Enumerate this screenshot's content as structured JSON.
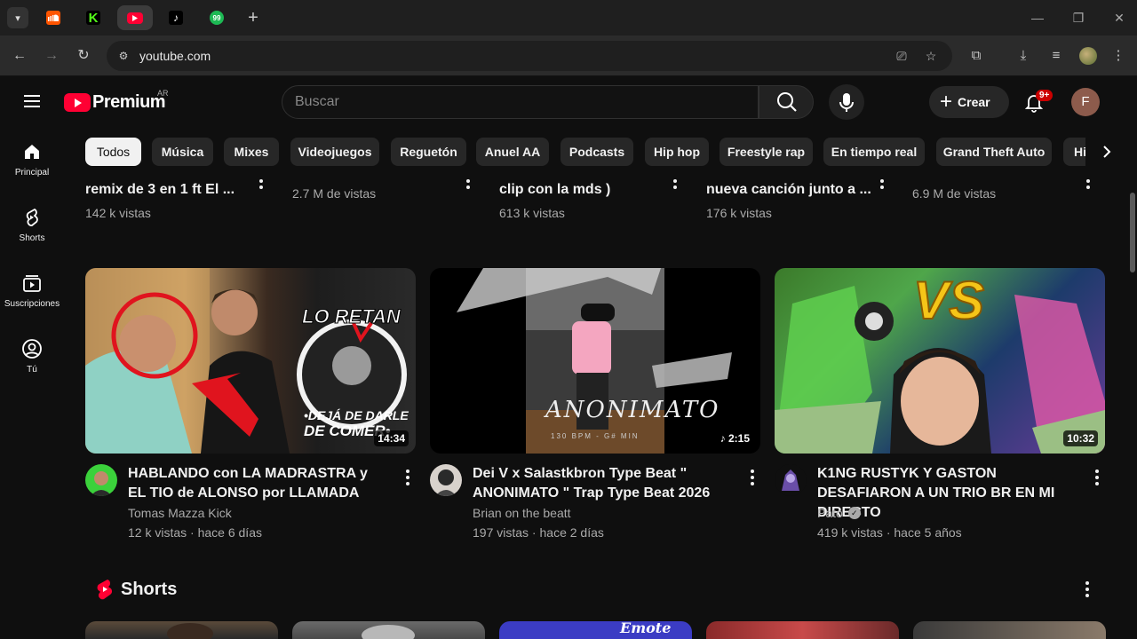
{
  "browser": {
    "tabs": [
      {
        "name": "soundcloud",
        "glyph": "",
        "color": "#ff5500",
        "active": false
      },
      {
        "name": "kick",
        "glyph": "K",
        "color": "#53fc18",
        "active": false
      },
      {
        "name": "youtube",
        "glyph": "",
        "color": "#ff0033",
        "active": true
      },
      {
        "name": "tiktok",
        "glyph": "♪",
        "color": "#000000",
        "active": false
      },
      {
        "name": "kick-99",
        "glyph": "99",
        "color": "#1db954",
        "active": false
      }
    ],
    "url": "youtube.com"
  },
  "masthead": {
    "logo_text": "Premium",
    "country_code": "AR",
    "search_placeholder": "Buscar",
    "create_label": "Crear",
    "notif_badge": "9+",
    "avatar_letter": "F"
  },
  "sidebar": {
    "items": [
      {
        "label": "Principal",
        "icon": "home-icon"
      },
      {
        "label": "Shorts",
        "icon": "shorts-icon"
      },
      {
        "label": "Suscripciones",
        "icon": "subscriptions-icon"
      },
      {
        "label": "Tú",
        "icon": "you-icon"
      }
    ]
  },
  "chips": [
    "Todos",
    "Música",
    "Mixes",
    "Videojuegos",
    "Reguetón",
    "Anuel AA",
    "Podcasts",
    "Hip hop",
    "Freestyle rap",
    "En tiempo real",
    "Grand Theft Auto",
    "Hi"
  ],
  "partial_row": [
    {
      "title": "remix de 3 en 1 ft El ...",
      "meta": "142 k vistas"
    },
    {
      "title": "",
      "meta": "2.7 M de vistas"
    },
    {
      "title": "clip con la mds  )",
      "meta": "613 k vistas"
    },
    {
      "title": "nueva canción junto a ...",
      "meta": "176 k vistas"
    },
    {
      "title": "",
      "meta": "6.9 M de vistas"
    }
  ],
  "videos": [
    {
      "title": "HABLANDO con LA MADRASTRA y EL TIO de ALONSO por LLAMADA",
      "channel": "Tomas Mazza Kick",
      "views": "12 k vistas",
      "age": "hace 6 días",
      "duration": "14:34",
      "thumb_text_1": "LO RETAN",
      "thumb_text_2": "•DEJÁ DE DARLE",
      "thumb_text_3": "DE COMER•",
      "verified": false
    },
    {
      "title": "Dei V x Salastkbron Type Beat \" ANONIMATO \" Trap Type Beat 2026",
      "channel": "Brian on the beatt",
      "views": "197 vistas",
      "age": "hace 2 días",
      "duration": "♪ 2:15",
      "thumb_text_1": "ANONIMATO",
      "thumb_text_2": "130 BPM - G# MIN",
      "verified": false
    },
    {
      "title": "K1NG RUSTYK Y GASTON DESAFIARON A UN TRIO BR EN MI DIRECTO",
      "channel": "Pato",
      "views": "419 k vistas",
      "age": "hace 5 años",
      "duration": "10:32",
      "thumb_text_1": "VS",
      "verified": true
    }
  ],
  "shorts": {
    "title": "Shorts",
    "items": [
      {
        "caption": ""
      },
      {
        "caption": ""
      },
      {
        "caption": "Emote"
      },
      {
        "caption": ""
      },
      {
        "caption": ""
      }
    ]
  },
  "colors": {
    "youtube_red": "#ff0033",
    "background": "#0f0f0f",
    "chip_bg": "#272727",
    "secondary_text": "#aaaaaa"
  }
}
